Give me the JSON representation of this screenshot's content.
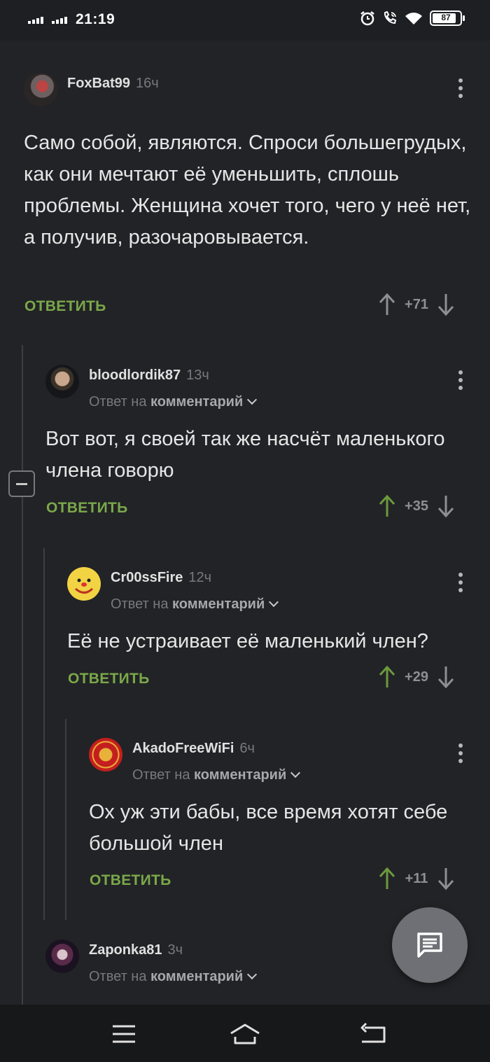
{
  "status_bar": {
    "time": "21:19",
    "battery": "87",
    "battery_level": 0.87
  },
  "comments": [
    {
      "user": "FoxBat99",
      "time": "16ч",
      "text": "Само собой, являются. Спроси большегрудых, как они мечтают её уменьшить, сплошь проблемы. Женщина хочет того, чего у неё нет, а получив, разочаровывается.",
      "reply_label": "ОТВЕТИТЬ",
      "score": "+71"
    },
    {
      "user": "bloodlordik87",
      "time": "13ч",
      "reply_prefix": "Ответ на",
      "reply_target": "комментарий",
      "text": "Вот вот, я своей так же насчёт маленького члена говорю",
      "reply_label": "ОТВЕТИТЬ",
      "score": "+35"
    },
    {
      "user": "Cr00ssFire",
      "time": "12ч",
      "reply_prefix": "Ответ на",
      "reply_target": "комментарий",
      "text": "Её не устраивает её маленький член?",
      "reply_label": "ОТВЕТИТЬ",
      "score": "+29"
    },
    {
      "user": "AkadoFreeWiFi",
      "time": "6ч",
      "reply_prefix": "Ответ на",
      "reply_target": "комментарий",
      "text": "Ох уж эти бабы, все время хотят себе большой член",
      "reply_label": "ОТВЕТИТЬ",
      "score": "+11"
    },
    {
      "user": "Zaponka81",
      "time": "3ч",
      "reply_prefix": "Ответ на",
      "reply_target": "комментарий"
    }
  ],
  "colors": {
    "background": "#222326",
    "accent_green": "#7aa84a",
    "upvoted": "#6b9a3e"
  },
  "icons": [
    "alarm-icon",
    "wifi-call-icon",
    "wifi-icon",
    "more-vert-icon",
    "arrow-up-icon",
    "arrow-down-icon",
    "chat-icon",
    "menu-icon",
    "home-icon",
    "back-icon"
  ]
}
